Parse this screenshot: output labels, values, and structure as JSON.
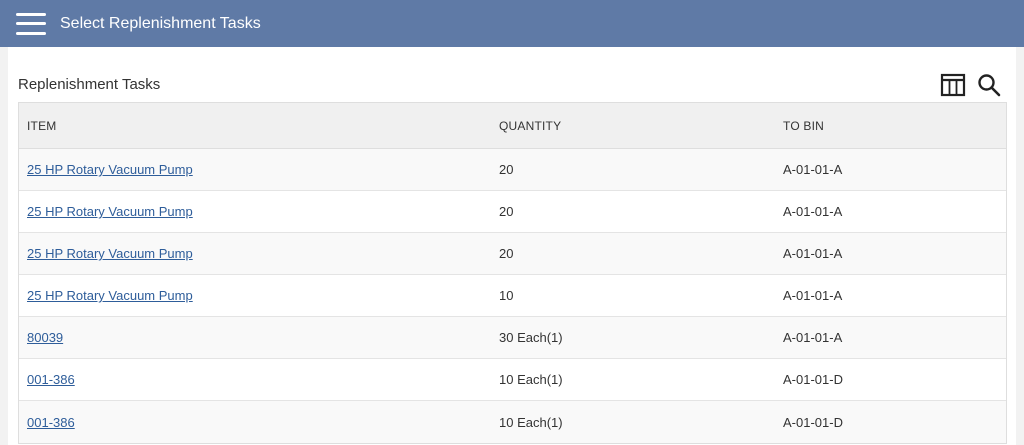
{
  "header": {
    "title": "Select Replenishment Tasks",
    "bg_color": "#5f7aa6"
  },
  "section": {
    "title": "Replenishment Tasks"
  },
  "toolbar": {
    "icons": [
      "columns-icon",
      "search-icon"
    ]
  },
  "table": {
    "columns": [
      "ITEM",
      "QUANTITY",
      "TO BIN"
    ],
    "rows": [
      {
        "item": "25 HP Rotary Vacuum Pump",
        "quantity": "20",
        "to_bin": "A-01-01-A"
      },
      {
        "item": "25 HP Rotary Vacuum Pump",
        "quantity": "20",
        "to_bin": "A-01-01-A"
      },
      {
        "item": "25 HP Rotary Vacuum Pump",
        "quantity": "20",
        "to_bin": "A-01-01-A"
      },
      {
        "item": "25 HP Rotary Vacuum Pump",
        "quantity": "10",
        "to_bin": "A-01-01-A"
      },
      {
        "item": "80039",
        "quantity": "30 Each(1)",
        "to_bin": "A-01-01-A"
      },
      {
        "item": "001-386",
        "quantity": "10 Each(1)",
        "to_bin": "A-01-01-D"
      },
      {
        "item": "001-386",
        "quantity": "10 Each(1)",
        "to_bin": "A-01-01-D"
      }
    ],
    "link_color": "#2e5d9a"
  }
}
